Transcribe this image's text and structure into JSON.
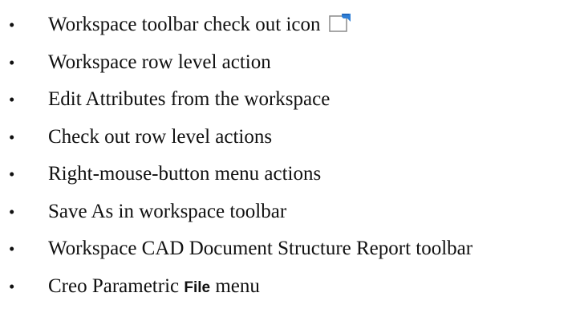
{
  "items": [
    {
      "text": "Workspace toolbar check out icon",
      "icon": "check-out-icon"
    },
    {
      "text": "Workspace row level action"
    },
    {
      "text": "Edit Attributes from the workspace"
    },
    {
      "text": "Check out row level actions"
    },
    {
      "text": "Right-mouse-button menu actions"
    },
    {
      "text": "Save As in workspace toolbar"
    },
    {
      "text": "Workspace CAD Document Structure Report toolbar"
    },
    {
      "text_before": "Creo Parametric",
      "text_bold": "File",
      "text_after": "menu"
    }
  ],
  "bullet_char": "•",
  "colors": {
    "text": "#111111",
    "icon_accent": "#2f7fd6",
    "icon_outline": "#8a8a8a"
  }
}
